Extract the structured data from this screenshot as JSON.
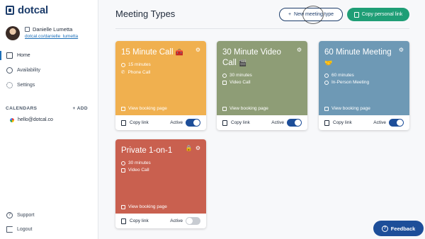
{
  "brand": {
    "name": "dotcal"
  },
  "profile": {
    "name": "Danielle Lumetta",
    "link": "dotcal.co/danielle_lumetta"
  },
  "nav": [
    {
      "label": "Home",
      "active": true
    },
    {
      "label": "Availability",
      "active": false
    },
    {
      "label": "Settings",
      "active": false
    }
  ],
  "calendars": {
    "heading": "CALENDARS",
    "add_label": "+ ADD",
    "items": [
      "hello@dotcal.co"
    ]
  },
  "footer_nav": {
    "support": "Support",
    "logout": "Logout"
  },
  "header": {
    "title": "Meeting Types",
    "new_button": "New meeting type",
    "copy_button": "Copy personal link"
  },
  "cards": [
    {
      "title": "15 Minute Call",
      "emoji": "🧰",
      "duration": "15 minutes",
      "location": "Phone Call",
      "view": "View booking page",
      "copy": "Copy link",
      "status": "Active",
      "active": true,
      "color": "#f0b04f",
      "locked": false
    },
    {
      "title": "30 Minute Video Call",
      "emoji": "🎬",
      "duration": "30 minutes",
      "location": "Video Call",
      "view": "View booking page",
      "copy": "Copy link",
      "status": "Active",
      "active": true,
      "color": "#8e9d76",
      "locked": false
    },
    {
      "title": "60 Minute Meeting",
      "emoji": "🤝",
      "duration": "60 minutes",
      "location": "In-Person Meeting",
      "view": "View booking page",
      "copy": "Copy link",
      "status": "Active",
      "active": true,
      "color": "#6e99b5",
      "locked": false
    },
    {
      "title": "Private 1-on-1",
      "emoji": "",
      "duration": "30 minutes",
      "location": "Video Call",
      "view": "View booking page",
      "copy": "Copy link",
      "status": "Active",
      "active": false,
      "color": "#c9604f",
      "locked": true
    }
  ],
  "feedback": {
    "label": "Feedback"
  }
}
